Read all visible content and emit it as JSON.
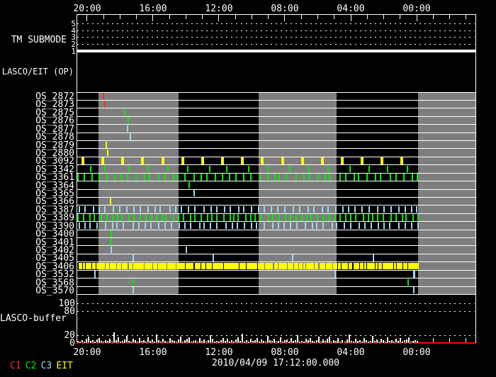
{
  "colors": {
    "background": "#000000",
    "foreground": "#ffffff",
    "gray_band": "#7e7e7e",
    "c1": "#ff2a2a",
    "c2": "#00ee00",
    "c3": "#9fd6f0",
    "eit": "#ffff00",
    "red_line": "#ff0000"
  },
  "legend": [
    {
      "text": "C1",
      "color": "c1"
    },
    {
      "text": "C2",
      "color": "c2"
    },
    {
      "text": "C3",
      "color": "c3"
    },
    {
      "text": "EIT",
      "color": "eit"
    }
  ],
  "footer": {
    "date": "2010/04/09 17:12:00.000"
  },
  "chart_data": {
    "type": "timeline",
    "time_axis": {
      "tick_labels": [
        "20:00",
        "16:00",
        "12:00",
        "08:00",
        "04:00",
        "00:00"
      ],
      "label_pcts": [
        0.0266,
        0.1918,
        0.357,
        0.5222,
        0.6874,
        0.8526
      ],
      "hour_step_pct": 0.0413
    },
    "gray_bands": [
      [
        0.0551,
        0.2558
      ],
      [
        0.4565,
        0.6519
      ],
      [
        0.8561,
        1.0
      ]
    ],
    "tm_submode": {
      "label": "TM SUBMODE",
      "scale_labels": [
        "5",
        "4",
        "3",
        "2",
        "1"
      ],
      "current_value": "1"
    },
    "lasco_eit_op": {
      "label": "LASCO/EIT (OP)",
      "events": []
    },
    "os_rows": [
      {
        "label": "OS_2872",
        "events": [
          {
            "pct": 0.068,
            "color": "c1",
            "w": 2
          }
        ]
      },
      {
        "label": "OS_2873",
        "events": [
          {
            "pct": 0.071,
            "color": "c1",
            "w": 2
          }
        ]
      },
      {
        "label": "OS_2875",
        "events": [
          {
            "pct": 0.121,
            "color": "c2",
            "w": 2
          }
        ]
      },
      {
        "label": "OS_2876",
        "events": [
          {
            "pct": 0.13,
            "color": "c2",
            "w": 2
          }
        ]
      },
      {
        "label": "OS_2877",
        "events": [
          {
            "pct": 0.128,
            "color": "c3",
            "w": 2
          }
        ]
      },
      {
        "label": "OS_2878",
        "events": [
          {
            "pct": 0.135,
            "color": "c3",
            "w": 2
          }
        ]
      },
      {
        "label": "OS_2879",
        "events": [
          {
            "pct": 0.075,
            "color": "eit",
            "w": 2
          }
        ]
      },
      {
        "label": "OS_2880",
        "events": [
          {
            "pct": 0.078,
            "color": "eit",
            "w": 2
          }
        ]
      },
      {
        "label": "OS_3092",
        "pattern": {
          "color": "eit",
          "start": 0.016,
          "end": 0.816,
          "count": 17,
          "jitter": 0,
          "w": 4
        }
      },
      {
        "label": "OS_3342",
        "pattern": {
          "color": "c2",
          "start": 0.028,
          "end": 0.83,
          "count": 17,
          "jitter": 0.3,
          "w": 2
        }
      },
      {
        "label": "OS_3361",
        "pattern": {
          "color": "c2",
          "start": 0.004,
          "end": 0.856,
          "count": 48,
          "jitter": 0.45,
          "w": 2
        }
      },
      {
        "label": "OS_3364",
        "events": [
          {
            "pct": 0.283,
            "color": "c2",
            "w": 2
          }
        ]
      },
      {
        "label": "OS_3365",
        "events": [
          {
            "pct": 0.295,
            "color": "c3",
            "w": 2
          }
        ]
      },
      {
        "label": "OS_3366",
        "events": [
          {
            "pct": 0.085,
            "color": "eit",
            "w": 2
          }
        ]
      },
      {
        "label": "OS_3387",
        "pattern": {
          "color": "c3",
          "start": 0.004,
          "end": 0.856,
          "count": 50,
          "jitter": 0.45,
          "w": 2
        }
      },
      {
        "label": "OS_3389",
        "pattern": {
          "color": "c2",
          "start": 0.004,
          "end": 0.856,
          "count": 62,
          "jitter": 0.5,
          "w": 2
        }
      },
      {
        "label": "OS_3390",
        "pattern": {
          "color": "c3",
          "start": 0.004,
          "end": 0.856,
          "count": 52,
          "jitter": 0.45,
          "w": 2
        }
      },
      {
        "label": "OS_3400",
        "events": [
          {
            "pct": 0.087,
            "color": "c2",
            "w": 2
          }
        ]
      },
      {
        "label": "OS_3401",
        "events": [
          {
            "pct": 0.085,
            "color": "c2",
            "w": 2
          }
        ]
      },
      {
        "label": "OS_3402",
        "events": [
          {
            "pct": 0.087,
            "color": "c3",
            "w": 2
          },
          {
            "pct": 0.276,
            "color": "c3",
            "w": 2
          }
        ]
      },
      {
        "label": "OS_3405",
        "events": [
          {
            "pct": 0.142,
            "color": "c3",
            "w": 2
          },
          {
            "pct": 0.343,
            "color": "c3",
            "w": 2
          },
          {
            "pct": 0.541,
            "color": "c3",
            "w": 2
          },
          {
            "pct": 0.744,
            "color": "c3",
            "w": 2
          }
        ]
      },
      {
        "label": "OS_3406",
        "pattern": {
          "color": "eit",
          "start": 0.007,
          "end": 0.855,
          "count": 150,
          "jitter": 0.5,
          "w": 3
        }
      },
      {
        "label": "OS_3532",
        "events": [
          {
            "pct": 0.046,
            "color": "c3",
            "w": 2
          },
          {
            "pct": 0.648,
            "color": "c3",
            "w": 2
          },
          {
            "pct": 0.846,
            "color": "c3",
            "w": 3
          }
        ]
      },
      {
        "label": "OS_3568",
        "events": [
          {
            "pct": 0.142,
            "color": "c2",
            "w": 2
          },
          {
            "pct": 0.831,
            "color": "c2",
            "w": 2
          }
        ]
      },
      {
        "label": "OS_3570",
        "events": [
          {
            "pct": 0.142,
            "color": "c3",
            "w": 2
          },
          {
            "pct": 0.846,
            "color": "c3",
            "w": 2
          }
        ]
      }
    ],
    "buffer": {
      "label": "LASCO-buffer",
      "ytick_labels": [
        "100",
        "80",
        "20",
        "0"
      ],
      "ytick_values": [
        100,
        80,
        20,
        0
      ],
      "ylim": [
        0,
        110
      ],
      "grid_values": [
        100,
        80,
        20
      ],
      "series_end_pct": 0.856,
      "values": [
        6,
        3,
        8,
        4,
        10,
        16,
        5,
        7,
        3,
        9,
        12,
        6,
        4,
        8,
        5,
        11,
        3,
        27,
        7,
        14,
        4,
        6,
        9,
        18,
        5,
        3,
        10,
        7,
        4,
        12,
        6,
        8,
        3,
        15,
        5,
        9,
        4,
        21,
        7,
        3,
        11,
        6,
        4,
        13,
        8,
        5,
        3,
        9,
        16,
        4,
        7,
        10,
        15,
        3,
        6,
        8,
        4,
        12,
        5,
        9,
        3,
        7,
        19,
        11,
        4,
        6,
        3,
        8,
        13,
        5,
        10,
        4,
        7,
        3,
        9,
        15,
        6,
        23,
        4,
        8,
        3,
        11,
        5,
        7,
        12,
        4,
        9,
        6,
        3,
        17,
        8,
        5,
        10,
        3,
        6,
        14,
        4,
        7,
        9,
        3,
        12,
        5,
        8,
        20,
        4,
        6,
        3,
        10,
        7,
        13,
        5,
        3,
        8,
        16,
        4,
        9,
        6,
        11,
        16,
        3,
        7,
        5,
        12,
        4,
        8,
        3,
        9,
        22,
        6,
        4,
        10,
        5,
        7,
        3,
        13,
        8,
        4,
        6,
        18,
        5,
        9,
        3,
        11,
        7,
        4,
        14,
        6,
        8,
        3,
        10,
        5,
        12,
        4,
        7,
        9,
        14,
        3,
        6,
        8,
        5
      ],
      "baseline_value": 0,
      "baseline_color": "red_line"
    }
  }
}
